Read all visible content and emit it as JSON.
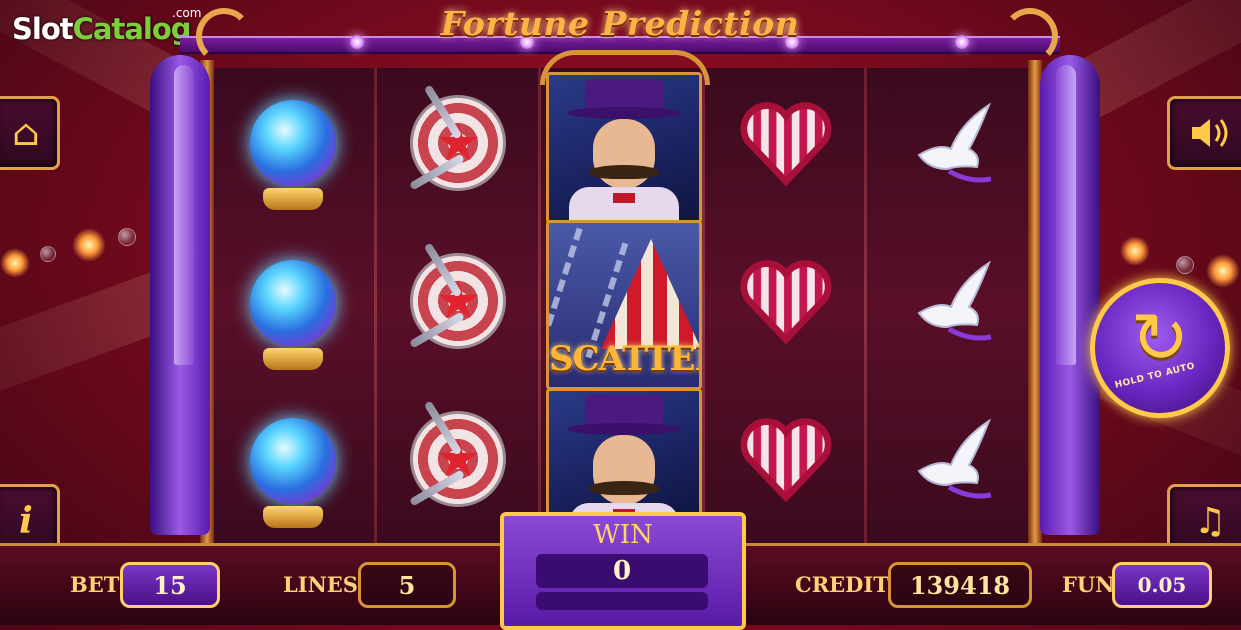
{
  "watermark": {
    "part1": "Slot",
    "part2": "Catalog",
    "suffix": ".com"
  },
  "game": {
    "title": "Fortune Prediction"
  },
  "reels": [
    [
      "crystal-ball",
      "crystal-ball",
      "crystal-ball"
    ],
    [
      "dart-target",
      "dart-target",
      "dart-target"
    ],
    [
      "magician",
      "scatter",
      "magician"
    ],
    [
      "striped-heart",
      "striped-heart",
      "striped-heart"
    ],
    [
      "white-dove",
      "white-dove",
      "white-dove"
    ]
  ],
  "scatter_label": "SCATTER",
  "buttons": {
    "home_icon": "home-icon",
    "info_icon": "info-icon",
    "sound_icon": "speaker-icon",
    "paytable_icon": "music-note-icon",
    "auto_spin_label": "HOLD TO AUTO"
  },
  "bottom": {
    "bet_label": "BET",
    "bet_value": "15",
    "lines_label": "LINES",
    "lines_value": "5",
    "win_label": "WIN",
    "win_value": "0",
    "credit_label": "CREDIT",
    "credit_value": "139418",
    "fun_label": "FUN",
    "fun_value": "0.05"
  },
  "colors": {
    "frame_gold": "#e0a14a",
    "panel_purple": "#6a26c0",
    "background_red": "#9a0e25"
  }
}
